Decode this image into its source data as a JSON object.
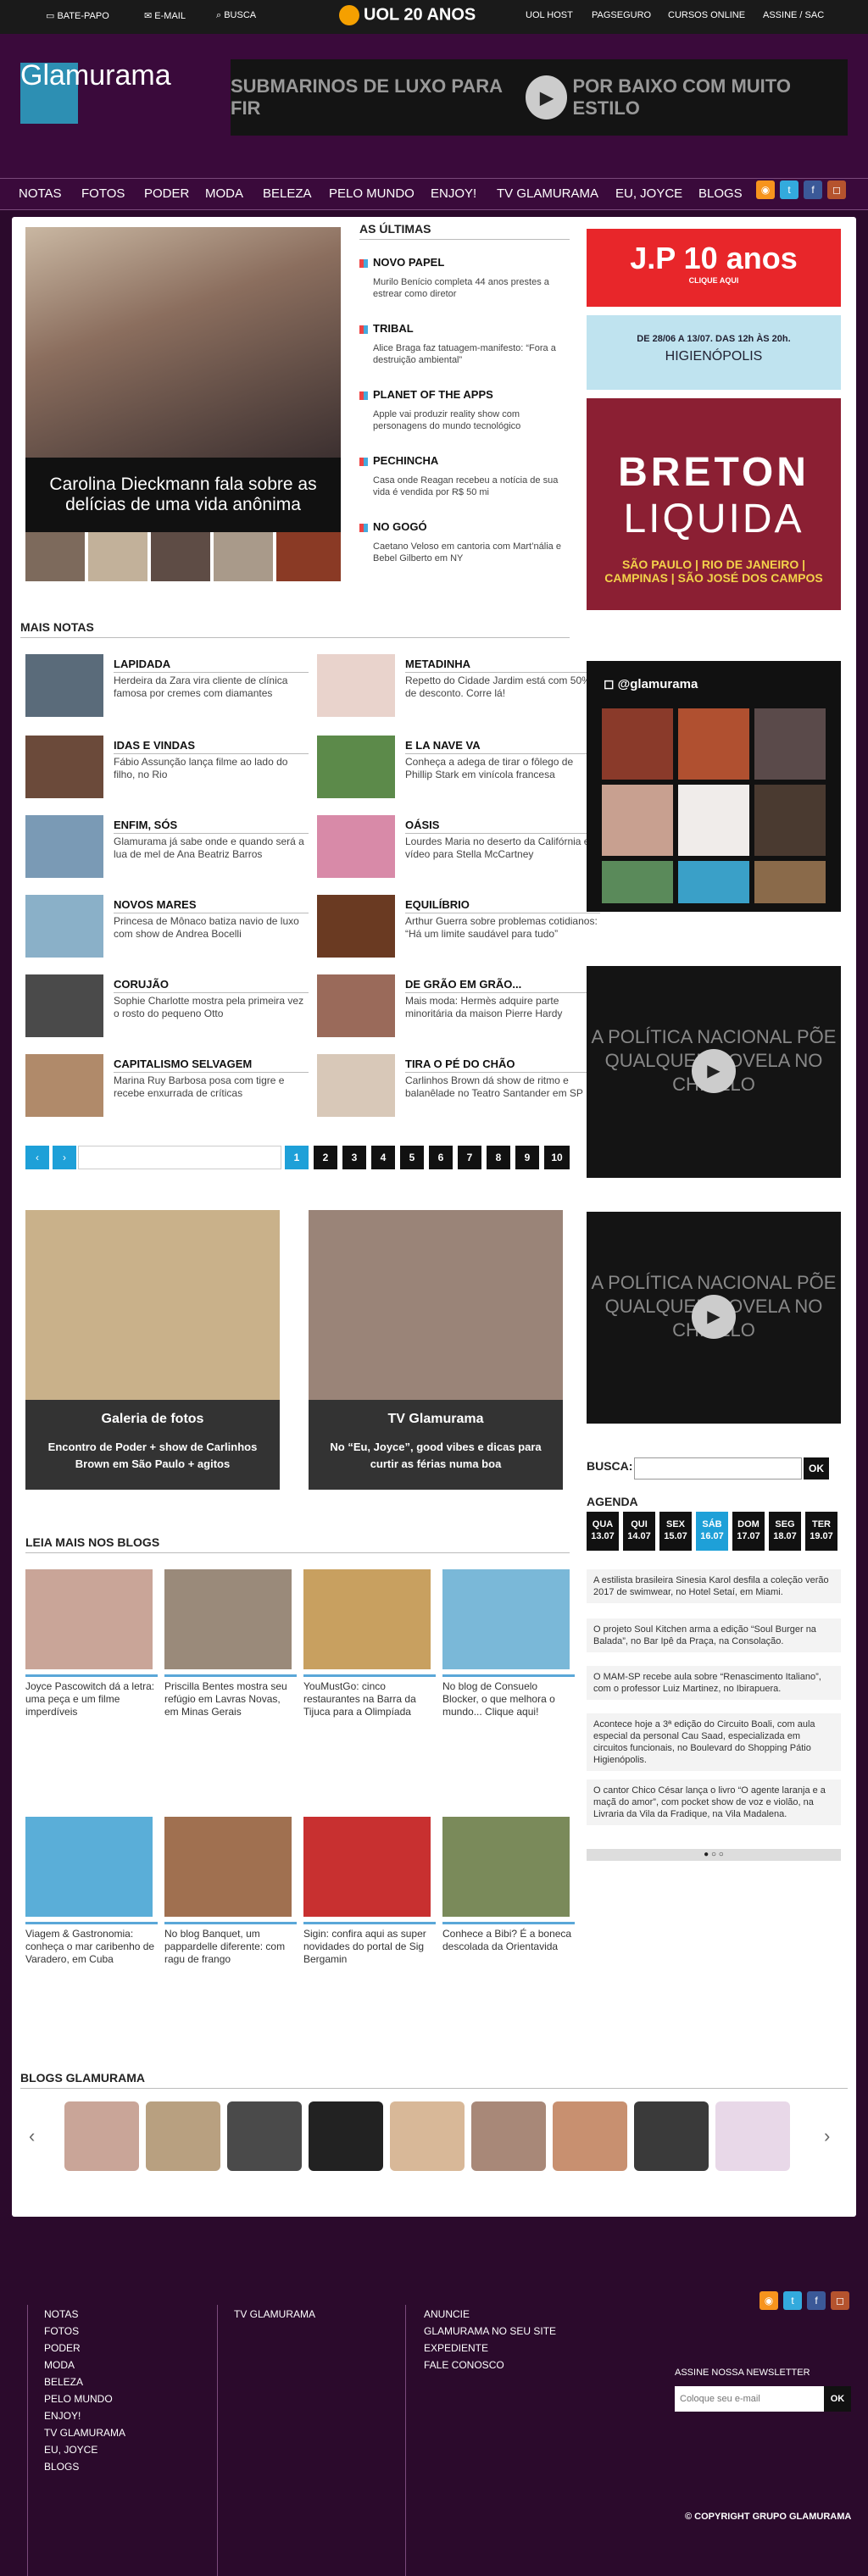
{
  "topbar": {
    "batepapo": "BATE-PAPO",
    "email": "E-MAIL",
    "busca": "BUSCA",
    "brand": "UOL",
    "brand_sub": "20 ANOS",
    "links": [
      "UOL HOST",
      "PAGSEGURO",
      "CURSOS ONLINE",
      "ASSINE / SAC"
    ]
  },
  "header": {
    "logo": "Glamurama",
    "ad_text": "SUBMARINOS DE LUXO PARA FIR",
    "ad_text_2": "POR BAIXO COM MUITO ESTILO"
  },
  "nav": [
    "NOTAS",
    "FOTOS",
    "PODER",
    "MODA",
    "BELEZA",
    "PELO MUNDO",
    "ENJOY!",
    "TV GLAMURAMA",
    "EU, JOYCE",
    "BLOGS"
  ],
  "featured": {
    "caption": "Carolina Dieckmann fala sobre as delícias de uma vida anônima"
  },
  "ultimas": {
    "title": "AS ÚLTIMAS",
    "items": [
      {
        "title": "NOVO PAPEL",
        "desc": "Murilo Benício completa 44 anos prestes a estrear como diretor"
      },
      {
        "title": "TRIBAL",
        "desc": "Alice Braga faz tatuagem-manifesto: “Fora a destruição ambiental”"
      },
      {
        "title": "PLANET OF THE APPS",
        "desc": "Apple vai produzir reality show com personagens do mundo tecnológico"
      },
      {
        "title": "PECHINCHA",
        "desc": "Casa onde Reagan recebeu a notícia de sua vida é vendida por R$ 50 mi"
      },
      {
        "title": "NO GOGÓ",
        "desc": "Caetano Veloso em cantoria com Mart’nália e Bebel Gilberto em NY"
      }
    ]
  },
  "mais_notas": {
    "title": "MAIS NOTAS",
    "items": [
      {
        "title": "LAPIDADA",
        "desc": "Herdeira da Zara vira cliente de clínica famosa por cremes com diamantes"
      },
      {
        "title": "METADINHA",
        "desc": "Repetto do Cidade Jardim está com 50% de desconto. Corre lá!"
      },
      {
        "title": "IDAS E VINDAS",
        "desc": "Fábio Assunção lança filme ao lado do filho, no Rio"
      },
      {
        "title": "E LA NAVE VA",
        "desc": "Conheça a adega de tirar o fôlego de Phillip Stark em vinícola francesa"
      },
      {
        "title": "ENFIM, SÓS",
        "desc": "Glamurama já sabe onde e quando será a lua de mel de Ana Beatriz Barros"
      },
      {
        "title": "OÁSIS",
        "desc": "Lourdes Maria no deserto da Califórnia em vídeo para Stella McCartney"
      },
      {
        "title": "NOVOS MARES",
        "desc": "Princesa de Mônaco batiza navio de luxo com show de Andrea Bocelli"
      },
      {
        "title": "EQUILÍBRIO",
        "desc": "Arthur Guerra sobre problemas cotidianos: “Há um limite saudável para tudo”"
      },
      {
        "title": "CORUJÃO",
        "desc": "Sophie Charlotte mostra pela primeira vez o rosto do pequeno Otto"
      },
      {
        "title": "DE GRÃO EM GRÃO...",
        "desc": "Mais moda: Hermès adquire parte minoritária da maison Pierre Hardy"
      },
      {
        "title": "CAPITALISMO SELVAGEM",
        "desc": "Marina Ruy Barbosa posa com tigre e recebe enxurrada de críticas"
      },
      {
        "title": "TIRA O PÉ DO CHÃO",
        "desc": "Carlinhos Brown dá show de ritmo e balanêlade no Teatro Santander em SP"
      }
    ],
    "pages": [
      "1",
      "2",
      "3",
      "4",
      "5",
      "6",
      "7",
      "8",
      "9",
      "10"
    ]
  },
  "galeria": {
    "title": "Galeria de fotos",
    "desc": "Encontro de Poder + show de Carlinhos Brown em São Paulo + agitos"
  },
  "tv": {
    "title": "TV Glamurama",
    "desc": "No “Eu, Joyce”, good vibes e dicas para curtir as férias numa boa"
  },
  "ads": {
    "jp": "J.P 10 anos",
    "jp_sub": "CLIQUE AQUI",
    "higienopolis_date": "DE 28/06 A 13/07. DAS 12h ÀS 20h.",
    "higienopolis_name": "HIGIENÓPOLIS",
    "breton_1": "BRETON",
    "breton_2": "LIQUIDA",
    "breton_3": "SÃO PAULO | RIO DE JANEIRO |",
    "breton_4": "CAMPINAS | SÃO JOSÉ DOS CAMPOS",
    "instagram": "@glamurama",
    "video_text": "A POLÍTICA NACIONAL PÕE QUALQUER NOVELA NO CHINELO"
  },
  "busca": {
    "label": "BUSCA:",
    "button": "OK"
  },
  "agenda": {
    "title": "AGENDA",
    "days": [
      {
        "d": "QUA",
        "n": "13.07"
      },
      {
        "d": "QUI",
        "n": "14.07"
      },
      {
        "d": "SEX",
        "n": "15.07"
      },
      {
        "d": "SÁB",
        "n": "16.07"
      },
      {
        "d": "DOM",
        "n": "17.07"
      },
      {
        "d": "SEG",
        "n": "18.07"
      },
      {
        "d": "TER",
        "n": "19.07"
      }
    ],
    "items": [
      "A estilista brasileira Sinesia Karol desfila a coleção verão 2017 de swimwear, no Hotel Setaí, em Miami.",
      "O projeto Soul Kitchen arma a edição “Soul Burger na Balada”, no Bar Ipê da Praça, na Consolação.",
      "O MAM-SP recebe aula sobre “Renascimento Italiano”, com o professor Luiz Martinez, no Ibirapuera.",
      "Acontece hoje a 3ª edição do Circuito Boali, com aula especial da personal Cau Saad, especializada em circuitos funcionais, no Boulevard do Shopping Pátio Higienópolis.",
      "O cantor Chico César lança o livro “O agente laranja e a maçã do amor”, com pocket show de voz e violão, na Livraria da Vila da Fradique, na Vila Madalena."
    ]
  },
  "leia_mais": {
    "title": "LEIA MAIS NOS BLOGS",
    "items": [
      "Joyce Pascowitch dá a letra: uma peça e um filme imperdíveis",
      "Priscilla Bentes mostra seu refúgio em Lavras Novas, em Minas Gerais",
      "YouMustGo: cinco restaurantes na Barra da Tijuca para a Olimpíada",
      "No blog de Consuelo Blocker, o que melhora o mundo... Clique aqui!",
      "Viagem & Gastronomia: conheça o mar caribenho de Varadero, em Cuba",
      "No blog Banquet, um pappardelle diferente: com ragu de frango",
      "Sigin: confira aqui as super novidades do portal de Sig Bergamin",
      "Conhece a Bibi? É a boneca descolada da Orientavida"
    ]
  },
  "blogs": {
    "title": "BLOGS GLAMURAMA"
  },
  "footer": {
    "col1": [
      "NOTAS",
      "FOTOS",
      "PODER",
      "MODA",
      "BELEZA",
      "PELO MUNDO",
      "ENJOY!",
      "TV GLAMURAMA",
      "EU, JOYCE",
      "BLOGS"
    ],
    "col2": [
      "TV GLAMURAMA"
    ],
    "col3": [
      "ANUNCIE",
      "GLAMURAMA NO SEU SITE",
      "EXPEDIENTE",
      "FALE CONOSCO"
    ],
    "newsletter": "ASSINE NOSSA NEWSLETTER",
    "newsletter_placeholder": "Coloque seu e-mail",
    "newsletter_btn": "OK",
    "copyright": "© COPYRIGHT GRUPO GLAMURAMA"
  }
}
